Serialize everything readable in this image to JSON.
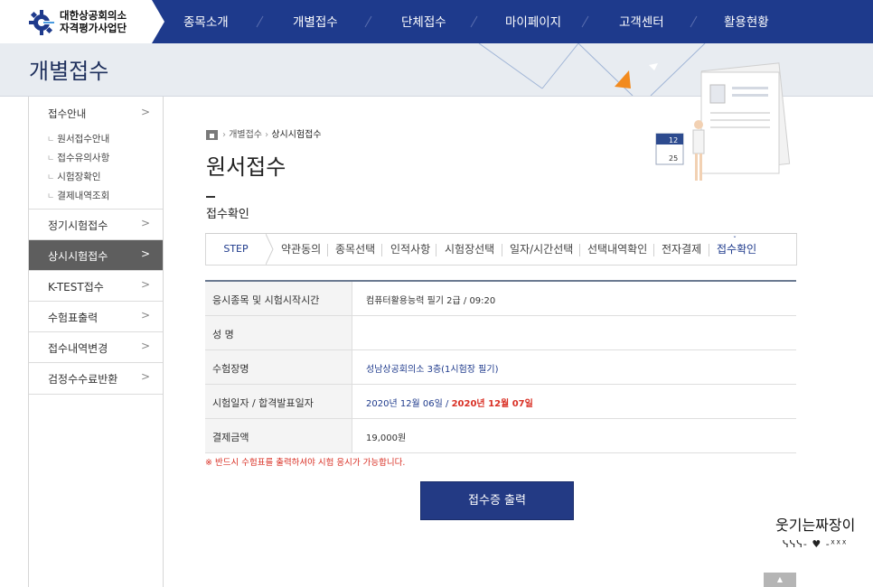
{
  "header": {
    "logo_line1": "대한상공회의소",
    "logo_line2": "자격평가사업단",
    "nav": [
      "종목소개",
      "개별접수",
      "단체접수",
      "마이페이지",
      "고객센터",
      "활용현황"
    ]
  },
  "banner": {
    "title": "개별접수"
  },
  "sidebar": {
    "group_title": "접수안내",
    "sub_items": [
      "원서접수안내",
      "접수유의사항",
      "시험장확인",
      "결제내역조회"
    ],
    "items": [
      {
        "label": "정기시험접수",
        "active": false
      },
      {
        "label": "상시시험접수",
        "active": true
      },
      {
        "label": "K-TEST접수",
        "active": false
      },
      {
        "label": "수험표출력",
        "active": false
      },
      {
        "label": "접수내역변경",
        "active": false
      },
      {
        "label": "검정수수료반환",
        "active": false
      }
    ]
  },
  "breadcrumb": {
    "level1": "개별접수",
    "level2": "상시시험접수"
  },
  "page_title": "원서접수",
  "section_title": "접수확인",
  "steps": {
    "first": "STEP",
    "items": [
      "약관동의",
      "종목선택",
      "인적사항",
      "시험장선택",
      "일자/시간선택",
      "선택내역확인",
      "전자결제",
      "접수확인"
    ],
    "current_index": 7
  },
  "table": {
    "rows": [
      {
        "label": "응시종목 및 시험시작시간",
        "value": "컴퓨터활용능력 필기 2급 / 09:20"
      },
      {
        "label": "성 명",
        "value": ""
      },
      {
        "label": "수험장명",
        "value": "성남상공회의소 3층(1시험장 필기)"
      },
      {
        "label": "시험일자 / 합격발표일자",
        "value": "2020년 12월 06일 / ",
        "value_red": "2020년 12월 07일"
      },
      {
        "label": "결제금액",
        "value": "19,000원"
      }
    ]
  },
  "notice": "※ 반드시 수험표를 출력하셔야 시험 응시가 가능합니다.",
  "print_button": "접수증 출력",
  "watermark": {
    "text": "웃기는짜장이",
    "deco": "ᓭᓭᓭ- ♥ -ᕽᕽᕽ"
  },
  "top_button": "TOP",
  "colors": {
    "nav_bg": "#1e3a8c",
    "button_bg": "#233a84",
    "alert_red": "#d93025"
  }
}
